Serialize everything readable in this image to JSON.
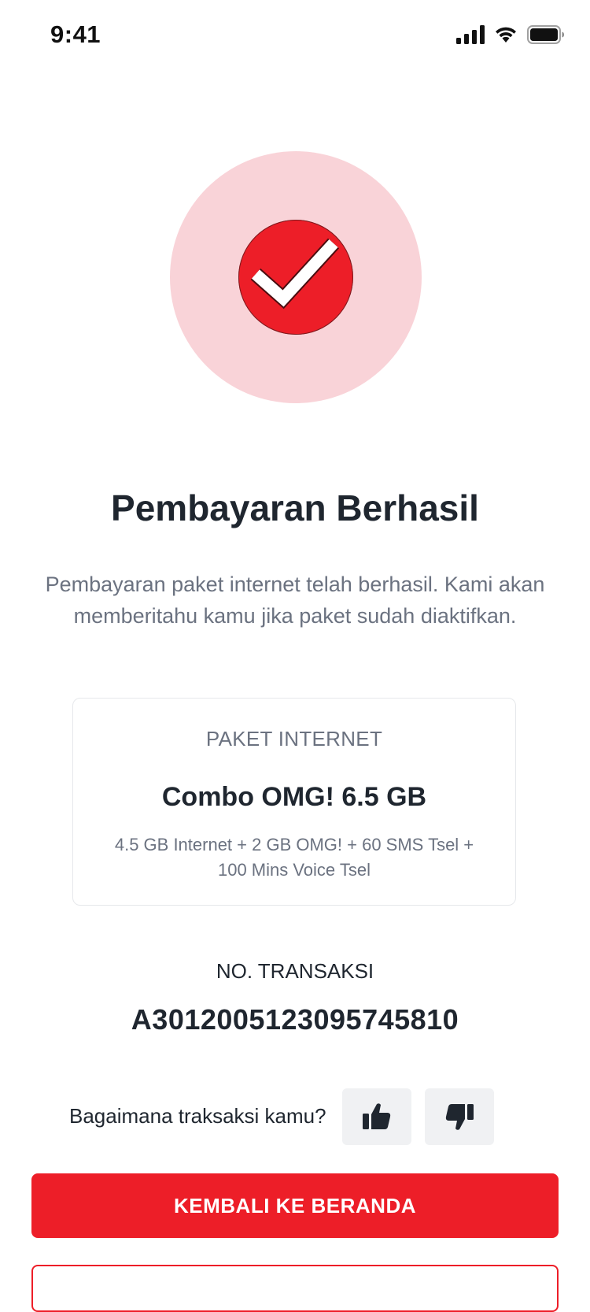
{
  "status_bar": {
    "time": "9:41"
  },
  "success": {
    "title": "Pembayaran Berhasil",
    "description": "Pembayaran paket internet telah berhasil. Kami akan memberitahu kamu jika paket sudah diaktifkan."
  },
  "package": {
    "label": "PAKET INTERNET",
    "name": "Combo OMG! 6.5 GB",
    "details": "4.5 GB Internet + 2 GB OMG! + 60 SMS Tsel + 100 Mins Voice Tsel"
  },
  "transaction": {
    "label": "NO. TRANSAKSI",
    "number": "A3012005123095745810"
  },
  "feedback": {
    "question": "Bagaimana traksaksi kamu?",
    "icons": [
      "thumbs-up-icon",
      "thumbs-down-icon"
    ]
  },
  "actions": {
    "home_label": "KEMBALI KE BERANDA"
  },
  "colors": {
    "brand_red": "#ed1e28",
    "light_pink": "#f9d3d8"
  }
}
